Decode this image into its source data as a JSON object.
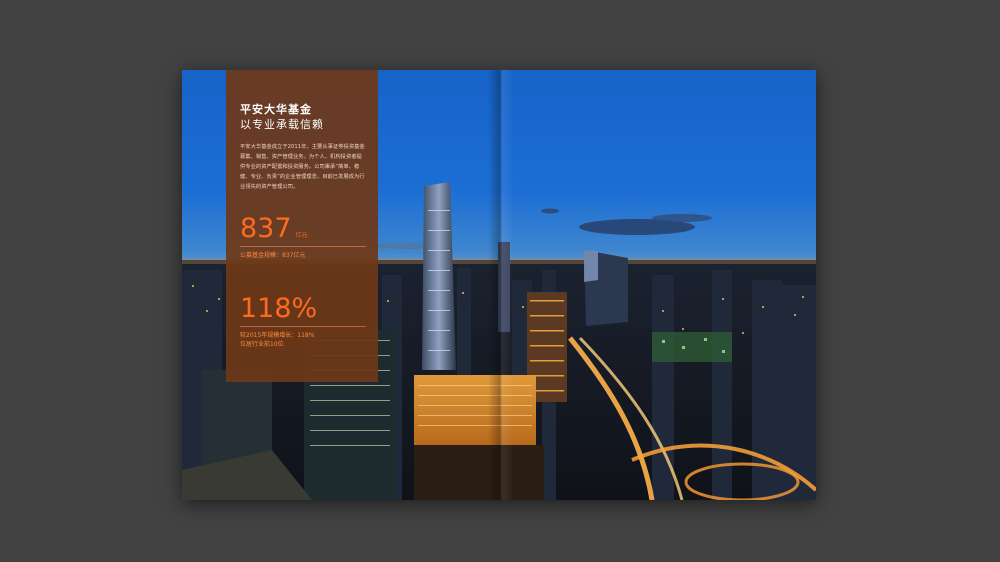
{
  "brochure": {
    "title": "平安大华基金",
    "subtitle": "以专业承载信赖",
    "body": "平安大华基金成立于2011年，主要从事证券投资基金募集、销售、资产管理业务。为个人、机构投资者提供专业的资产配置和投资服务。公司秉承“简单、稳健、专业、负责”的企业管理理念，目前已发展成为行业领先的资产管理公司。",
    "stats": [
      {
        "number": "837",
        "unit": "亿元",
        "caption": "公募基金规模：837亿元"
      },
      {
        "number": "118%",
        "unit": "",
        "caption": "较2015年规模增长：118%\n位居行业前10位"
      }
    ]
  },
  "colors": {
    "background": "#424242",
    "panel": "#6e3818",
    "accent": "#ff6a1f"
  }
}
